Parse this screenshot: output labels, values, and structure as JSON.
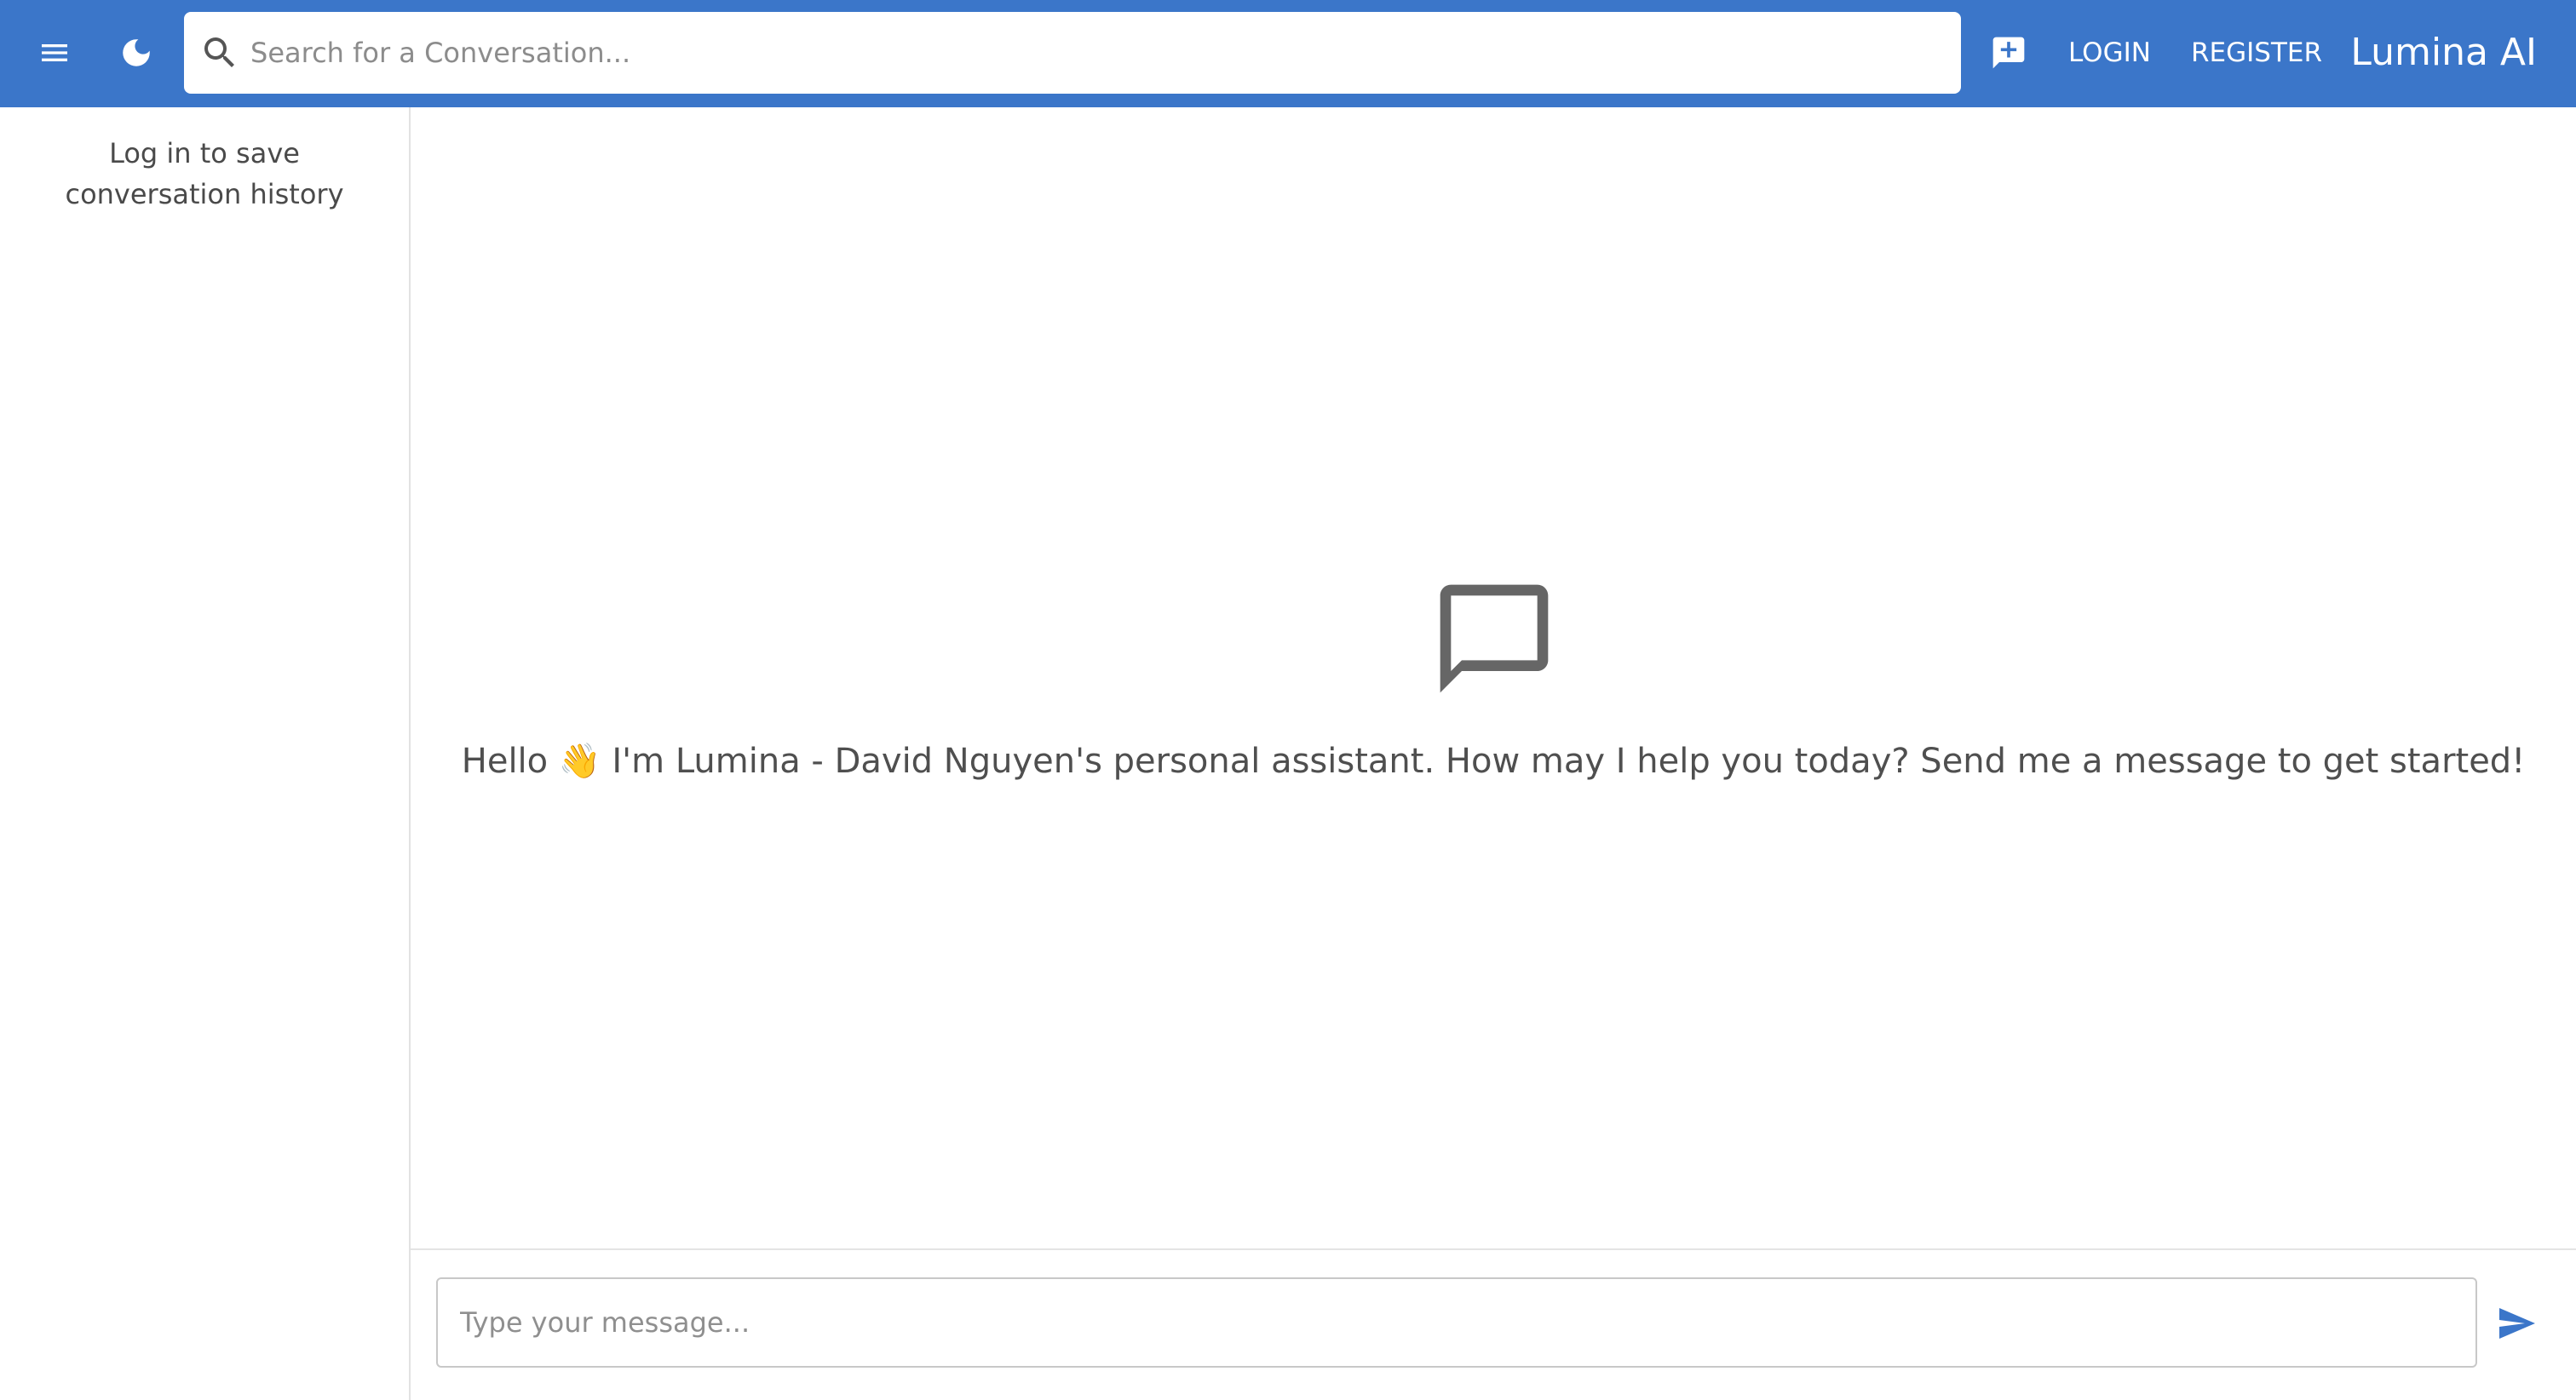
{
  "colors": {
    "appbar": "#3b76c9",
    "appbar_text": "#ffffff",
    "accent": "#3b76c9",
    "muted_icon": "#666666",
    "body_text": "#4f4f4f"
  },
  "header": {
    "menu_icon": "hamburger-menu-icon",
    "theme_icon": "dark-mode-moon-icon",
    "search": {
      "icon": "search-icon",
      "placeholder": "Search for a Conversation...",
      "value": ""
    },
    "new_chat_icon": "new-chat-icon",
    "login_label": "LOGIN",
    "register_label": "REGISTER",
    "brand": "Lumina AI"
  },
  "sidebar": {
    "hint": "Log in to save conversation history"
  },
  "main": {
    "empty_icon": "chat-bubble-outline-icon",
    "welcome": "Hello 👋 I'm Lumina - David Nguyen's personal assistant. How may I help you today? Send me a message to get started!"
  },
  "composer": {
    "placeholder": "Type your message...",
    "value": "",
    "send_icon": "send-icon"
  }
}
